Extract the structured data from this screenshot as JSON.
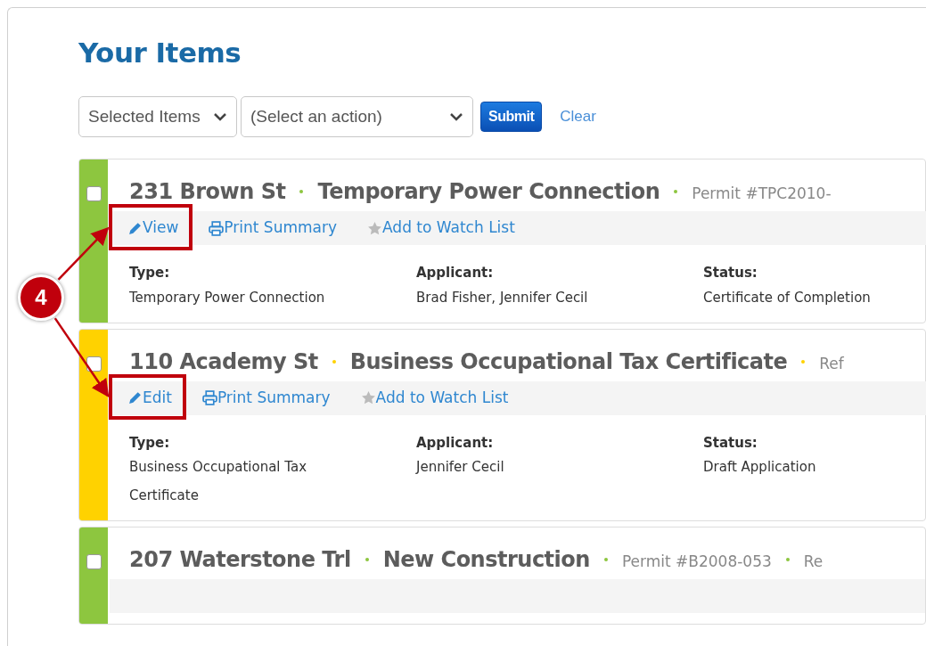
{
  "title": "Your Items",
  "toolbar": {
    "scope_select": "Selected Items",
    "action_select": "(Select an action)",
    "submit": "Submit",
    "clear": "Clear"
  },
  "callout": {
    "number": "4"
  },
  "items": [
    {
      "checked": false,
      "color": "#8dc63f",
      "address": "231 Brown St",
      "name": "Temporary Power Connection",
      "references": [
        "Permit #TPC2010-"
      ],
      "actions": [
        {
          "kind": "edit",
          "label": "View",
          "highlighted": true
        },
        {
          "kind": "print",
          "label": "Print Summary",
          "highlighted": false
        },
        {
          "kind": "watch",
          "label": "Add to Watch List",
          "highlighted": false
        }
      ],
      "fields": [
        {
          "label": "Type:",
          "value": "Temporary Power Connection"
        },
        {
          "label": "Applicant:",
          "value": "Brad Fisher, Jennifer Cecil"
        },
        {
          "label": "Status:",
          "value": "Certificate of Completion"
        }
      ]
    },
    {
      "checked": false,
      "color": "#ffd200",
      "address": "110 Academy St",
      "name": "Business Occupational Tax Certificate",
      "references": [
        "Ref"
      ],
      "actions": [
        {
          "kind": "edit",
          "label": "Edit",
          "highlighted": true
        },
        {
          "kind": "print",
          "label": "Print Summary",
          "highlighted": false
        },
        {
          "kind": "watch",
          "label": "Add to Watch List",
          "highlighted": false
        }
      ],
      "fields": [
        {
          "label": "Type:",
          "value": "Business Occupational Tax Certificate"
        },
        {
          "label": "Applicant:",
          "value": "Jennifer Cecil"
        },
        {
          "label": "Status:",
          "value": "Draft Application"
        }
      ]
    },
    {
      "checked": false,
      "color": "#8dc63f",
      "address": "207 Waterstone Trl",
      "name": "New Construction",
      "references": [
        "Permit #B2008-053",
        "Re"
      ]
    }
  ]
}
